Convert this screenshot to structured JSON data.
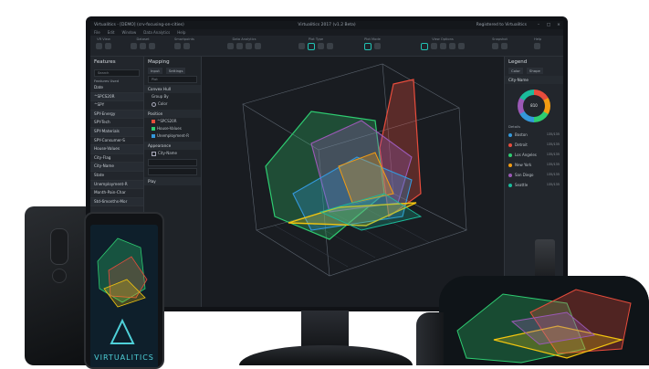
{
  "window": {
    "app_name": "Virtualitics - [DEMO] (crv-focusing-on-cities)",
    "title": "Virtualitics 2017 (v1.2 Beta)",
    "registration": "Registered to Virtualitics",
    "minimize": "–",
    "maximize": "□",
    "close": "×"
  },
  "menu": [
    "File",
    "Edit",
    "Window",
    "Data Analytics",
    "Help"
  ],
  "toolbar_groups": [
    {
      "label": "VR View",
      "icons": [
        "vr-icon",
        "eye-icon"
      ]
    },
    {
      "label": "Dataset",
      "icons": [
        "folder-icon",
        "save-icon",
        "refresh-icon"
      ]
    },
    {
      "label": "Smartpoints",
      "icons": [
        "point-icon",
        "cluster-icon"
      ]
    },
    {
      "label": "Data Analytics",
      "icons": [
        "chart-icon",
        "stats-icon",
        "filter-icon",
        "graph-icon"
      ]
    },
    {
      "label": "Plot Type",
      "icons": [
        "scatter-icon",
        "hull-icon",
        "histogram-icon",
        "surface-icon"
      ]
    },
    {
      "label": "Plot Mode",
      "icons": [
        "mode-a-icon",
        "mode-b-icon"
      ]
    },
    {
      "label": "View Options",
      "icons": [
        "cursor-icon",
        "globe-icon",
        "grid-icon",
        "axis-icon",
        "label-icon"
      ]
    },
    {
      "label": "Snapshot",
      "icons": [
        "camera-icon",
        "share-icon"
      ]
    },
    {
      "label": "Help",
      "icons": [
        "help-icon"
      ]
    }
  ],
  "features": {
    "title": "Features",
    "search_placeholder": "Search",
    "sub_label": "Features Used",
    "items": [
      "Date",
      "^SPCS20R",
      "^SPY",
      "SPY-Energy",
      "SPY-Tech",
      "SPY-Materials",
      "SPY-Consumer-S",
      "House-Values",
      "City-Flag",
      "City-Name",
      "State",
      "Unemployment-R",
      "Month-Pain-Char",
      "Std-6months-Mor"
    ]
  },
  "mapping": {
    "title": "Mapping",
    "tabs": [
      "Input",
      "Settings"
    ],
    "plot_type_value": "Plot",
    "convex_hull_label": "Convex Hull",
    "group_by_label": "Group By",
    "color_option": "Color",
    "position_label": "Position",
    "position_items": [
      "^SPCS20R",
      "House-Values",
      "Unemployment-R"
    ],
    "appearance_label": "Appearance",
    "appearance_items": [
      "City-Name"
    ],
    "play_label": "Play"
  },
  "legend": {
    "title": "Legend",
    "tabs": [
      "Color",
      "Shape"
    ],
    "group_label": "City-Name",
    "total_label": "810",
    "details_label": "Details",
    "items": [
      {
        "name": "Boston",
        "count": "135/135",
        "color": "#3498db"
      },
      {
        "name": "Detroit",
        "count": "135/135",
        "color": "#e74c3c"
      },
      {
        "name": "Los Angeles",
        "count": "135/135",
        "color": "#2ecc71"
      },
      {
        "name": "New York",
        "count": "135/135",
        "color": "#f39c12"
      },
      {
        "name": "San Diego",
        "count": "135/135",
        "color": "#9b59b6"
      },
      {
        "name": "Seattle",
        "count": "135/135",
        "color": "#1abc9c"
      }
    ]
  },
  "brand_logo": "VIRTUALITICS",
  "colors": {
    "accent": "#21c3b4",
    "panel": "#22262c",
    "viewport": "#191c21"
  }
}
